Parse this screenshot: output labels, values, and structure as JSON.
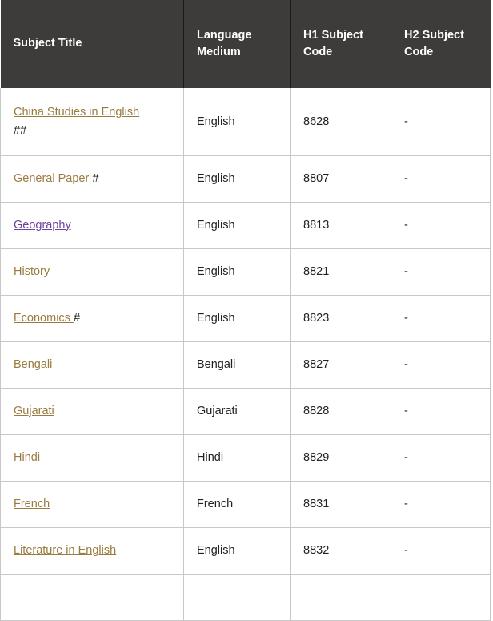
{
  "table": {
    "headers": [
      {
        "line1": "Subject Title",
        "line2": ""
      },
      {
        "line1": "Language",
        "line2": "Medium"
      },
      {
        "line1": "H1 Subject",
        "line2": "Code"
      },
      {
        "line1": "H2 Subject",
        "line2": "Code"
      }
    ],
    "colors": {
      "header_background": "#3e3c3a",
      "header_text": "#ffffff",
      "link": "#9a7b3f",
      "link_visited": "#6f3f9e",
      "cell_text": "#222222",
      "border": "#c8c8c8"
    },
    "rows": [
      {
        "subject": "China Studies in English",
        "marker": "##",
        "marker_position": "block",
        "visited": false,
        "language_medium": "English",
        "h1_subject_code": "8628",
        "h2_subject_code": "-"
      },
      {
        "subject": "General Paper ",
        "marker": "#",
        "marker_position": "inline",
        "visited": false,
        "language_medium": "English",
        "h1_subject_code": "8807",
        "h2_subject_code": "-"
      },
      {
        "subject": "Geography",
        "marker": "",
        "marker_position": "inline",
        "visited": true,
        "language_medium": "English",
        "h1_subject_code": "8813",
        "h2_subject_code": "-"
      },
      {
        "subject": "History",
        "marker": "",
        "marker_position": "inline",
        "visited": false,
        "language_medium": "English",
        "h1_subject_code": "8821",
        "h2_subject_code": "-"
      },
      {
        "subject": "Economics ",
        "marker": "#",
        "marker_position": "inline",
        "visited": false,
        "language_medium": "English",
        "h1_subject_code": "8823",
        "h2_subject_code": "-"
      },
      {
        "subject": "Bengali",
        "marker": "",
        "marker_position": "inline",
        "visited": false,
        "language_medium": "Bengali",
        "h1_subject_code": "8827",
        "h2_subject_code": "-"
      },
      {
        "subject": "Gujarati",
        "marker": "",
        "marker_position": "inline",
        "visited": false,
        "language_medium": "Gujarati",
        "h1_subject_code": "8828",
        "h2_subject_code": "-"
      },
      {
        "subject": "Hindi",
        "marker": "",
        "marker_position": "inline",
        "visited": false,
        "language_medium": "Hindi",
        "h1_subject_code": "8829",
        "h2_subject_code": "-"
      },
      {
        "subject": "French",
        "marker": "",
        "marker_position": "inline",
        "visited": false,
        "language_medium": "French",
        "h1_subject_code": "8831",
        "h2_subject_code": "-"
      },
      {
        "subject": "Literature in English",
        "marker": "",
        "marker_position": "inline",
        "visited": false,
        "language_medium": "English",
        "h1_subject_code": "8832",
        "h2_subject_code": "-"
      },
      {
        "subject": "",
        "marker": "",
        "marker_position": "inline",
        "visited": false,
        "language_medium": "",
        "h1_subject_code": "",
        "h2_subject_code": ""
      }
    ]
  }
}
